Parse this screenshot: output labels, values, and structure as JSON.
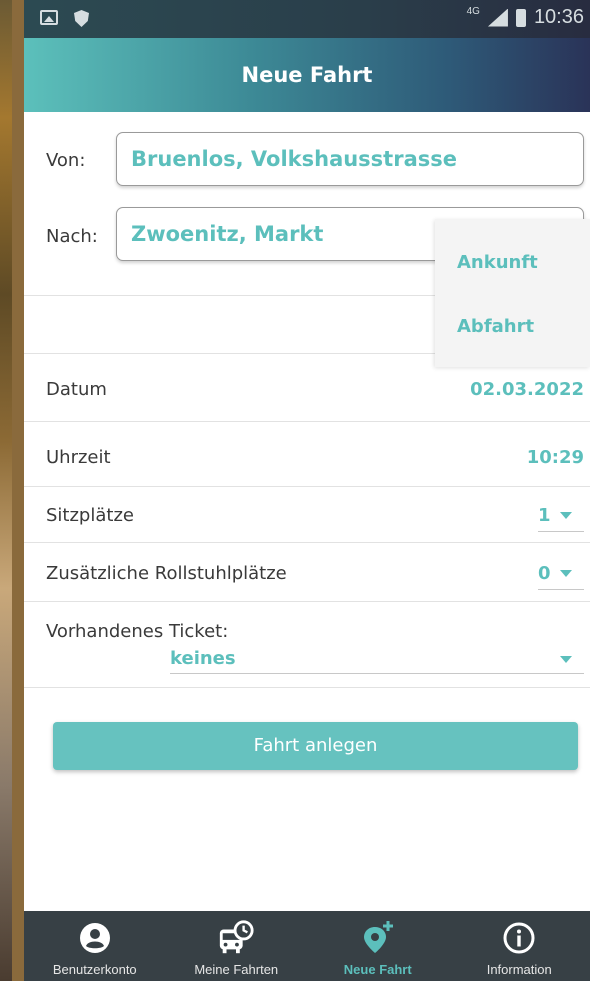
{
  "status_bar": {
    "network": "4G",
    "time": "10:36"
  },
  "header": {
    "title": "Neue Fahrt"
  },
  "form": {
    "from_label": "Von:",
    "from_value": "Bruenlos, Volkshausstrasse",
    "to_label": "Nach:",
    "to_value": "Zwoenitz, Markt",
    "date_label": "Datum",
    "date_value": "02.03.2022",
    "time_label": "Uhrzeit",
    "time_value": "10:29",
    "seats_label": "Sitzplätze",
    "seats_value": "1",
    "wheelchair_label": "Zusätzliche Rollstuhlplätze",
    "wheelchair_value": "0",
    "ticket_label": "Vorhandenes Ticket:",
    "ticket_value": "keines"
  },
  "popup_menu": {
    "items": [
      "Ankunft",
      "Abfahrt"
    ]
  },
  "actions": {
    "submit_label": "Fahrt anlegen"
  },
  "bottom_nav": {
    "items": [
      {
        "label": "Benutzerkonto",
        "icon": "account-icon"
      },
      {
        "label": "Meine Fahrten",
        "icon": "bus-clock-icon"
      },
      {
        "label": "Neue Fahrt",
        "icon": "location-add-icon",
        "active": true
      },
      {
        "label": "Information",
        "icon": "info-icon"
      }
    ]
  },
  "colors": {
    "accent": "#5cbfbc",
    "nav_bg": "#374045",
    "button": "#66c2bf"
  }
}
